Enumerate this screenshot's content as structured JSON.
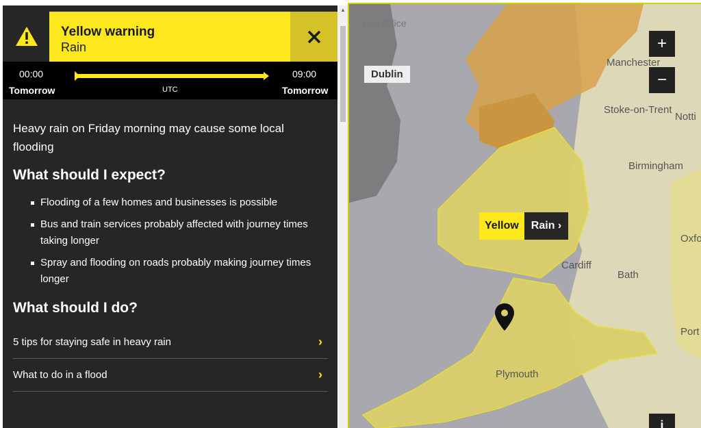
{
  "warning": {
    "level": "Yellow warning",
    "type": "Rain"
  },
  "timeline": {
    "start_time": "00:00",
    "start_day": "Tomorrow",
    "end_time": "09:00",
    "end_day": "Tomorrow",
    "timezone": "UTC"
  },
  "content": {
    "summary": "Heavy rain on Friday morning may cause some local flooding",
    "expect_heading": "What should I expect?",
    "expect_items": [
      "Flooding of a few homes and businesses is possible",
      "Bus and train services probably affected with journey times taking longer",
      "Spray and flooding on roads probably making journey times longer"
    ],
    "do_heading": "What should I do?",
    "links": [
      "5 tips for staying safe in heavy rain",
      "What to do in a flood"
    ]
  },
  "map": {
    "brand": "Met Office",
    "places": {
      "dublin": "Dublin",
      "manchester": "Manchester",
      "stoke": "Stoke-on-Trent",
      "nottingham": "Notti",
      "birmingham": "Birmingham",
      "oxford": "Oxfo",
      "cardiff": "Cardiff",
      "bath": "Bath",
      "portsmouth": "Port",
      "plymouth": "Plymouth"
    },
    "badge_level": "Yellow",
    "badge_type": "Rain",
    "zoom_in": "+",
    "zoom_out": "−",
    "info": "i"
  },
  "colors": {
    "warning_yellow": "#fde81e",
    "amber_area": "#d8a24a",
    "yellow_area": "#d9cf6a",
    "panel_bg": "#262626"
  }
}
